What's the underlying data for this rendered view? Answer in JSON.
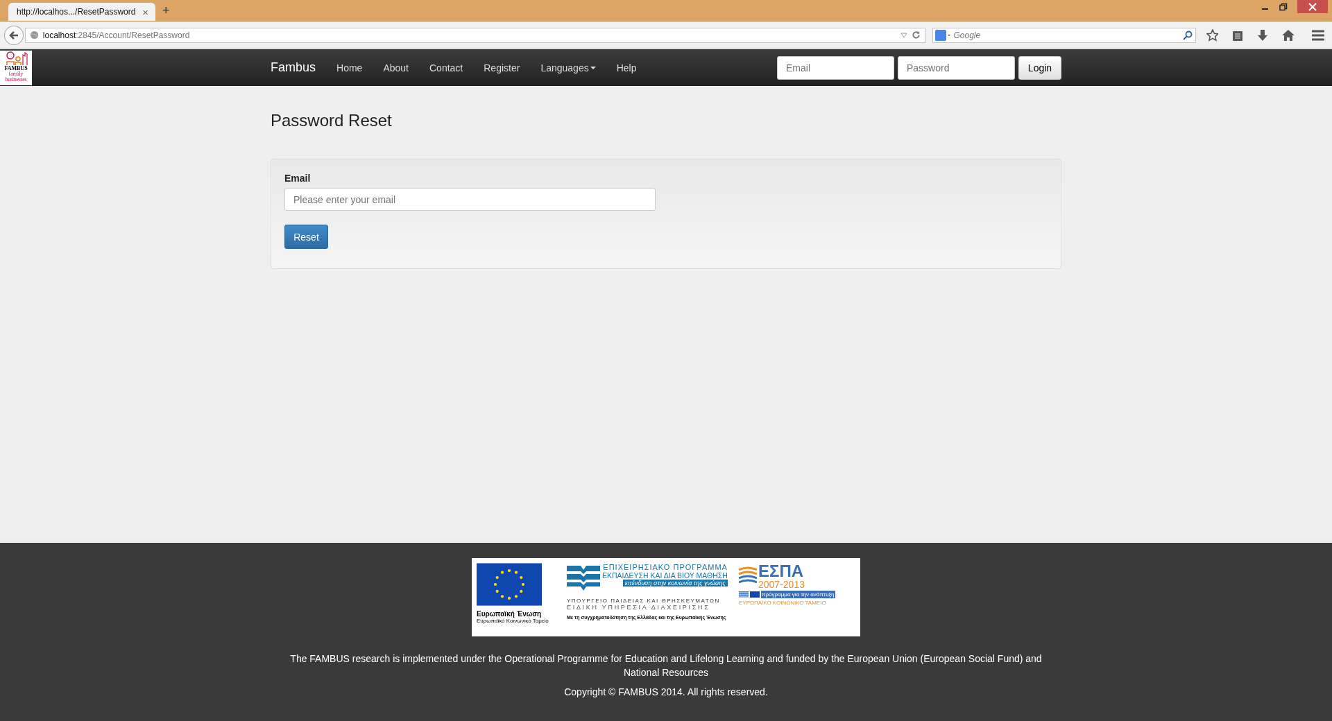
{
  "browser": {
    "tab": {
      "title": "http://localhos.../ResetPassword",
      "close": "×",
      "new_tab": "+"
    },
    "url": {
      "host": "localhost",
      "path": ":2845/Account/ResetPassword"
    },
    "search": {
      "placeholder": "Google"
    }
  },
  "site_logo": {
    "name": "FAMBUS",
    "line_1": "family",
    "line_2": "businesses"
  },
  "navbar": {
    "brand": "Fambus",
    "items": [
      {
        "label": "Home",
        "dropdown": false
      },
      {
        "label": "About",
        "dropdown": false
      },
      {
        "label": "Contact",
        "dropdown": false
      },
      {
        "label": "Register",
        "dropdown": false
      },
      {
        "label": "Languages",
        "dropdown": true
      },
      {
        "label": "Help",
        "dropdown": false
      }
    ],
    "login": {
      "email_placeholder": "Email",
      "password_placeholder": "Password",
      "button": "Login"
    }
  },
  "page": {
    "title": "Password Reset",
    "form": {
      "label": "Email",
      "placeholder": "Please enter your email",
      "button": "Reset"
    }
  },
  "footer": {
    "banner": {
      "eu_name": "Ευρωπαϊκή Ένωση",
      "eu_fund": "Ευρωπαϊκό Κοινωνικό Ταμείο",
      "op_title": "ΕΠΙΧΕΙΡΗΣΙΑΚΟ ΠΡΟΓΡΑΜΜΑ",
      "op_name": "ΕΚΠΑΙΔΕΥΣΗ ΚΑΙ ΔΙΑ ΒΙΟΥ ΜΑΘΗΣΗ",
      "op_motto": "επένδυση στην κοινωνία της γνώσης",
      "ministry": "ΥΠΟΥΡΓΕΙΟ ΠΑΙΔΕΙΑΣ ΚΑΙ ΘΡΗΣΚΕΥΜΑΤΩΝ",
      "service": "ΕΙΔΙΚΗ ΥΠΗΡΕΣΙΑ ΔΙΑΧΕΙΡΙΣΗΣ",
      "cofund": "Με τη συγχρηματοδότηση της Ελλάδας και της Ευρωπαϊκής Ένωσης",
      "espa": "ΕΣΠΑ",
      "espa_years": "2007-2013",
      "espa_slogan": "πρόγραμμα για την ανάπτυξη",
      "espa_fund": "ΕΥΡΩΠΑΪΚΟ ΚΟΙΝΩΝΙΚΟ ΤΑΜΕΙΟ"
    },
    "text": "The FAMBUS research is implemented under the Operational Programme for Education and Lifelong Learning and funded by the European Union (European Social Fund) and National Resources",
    "copyright": "Copyright © FAMBUS 2014. All rights reserved."
  }
}
